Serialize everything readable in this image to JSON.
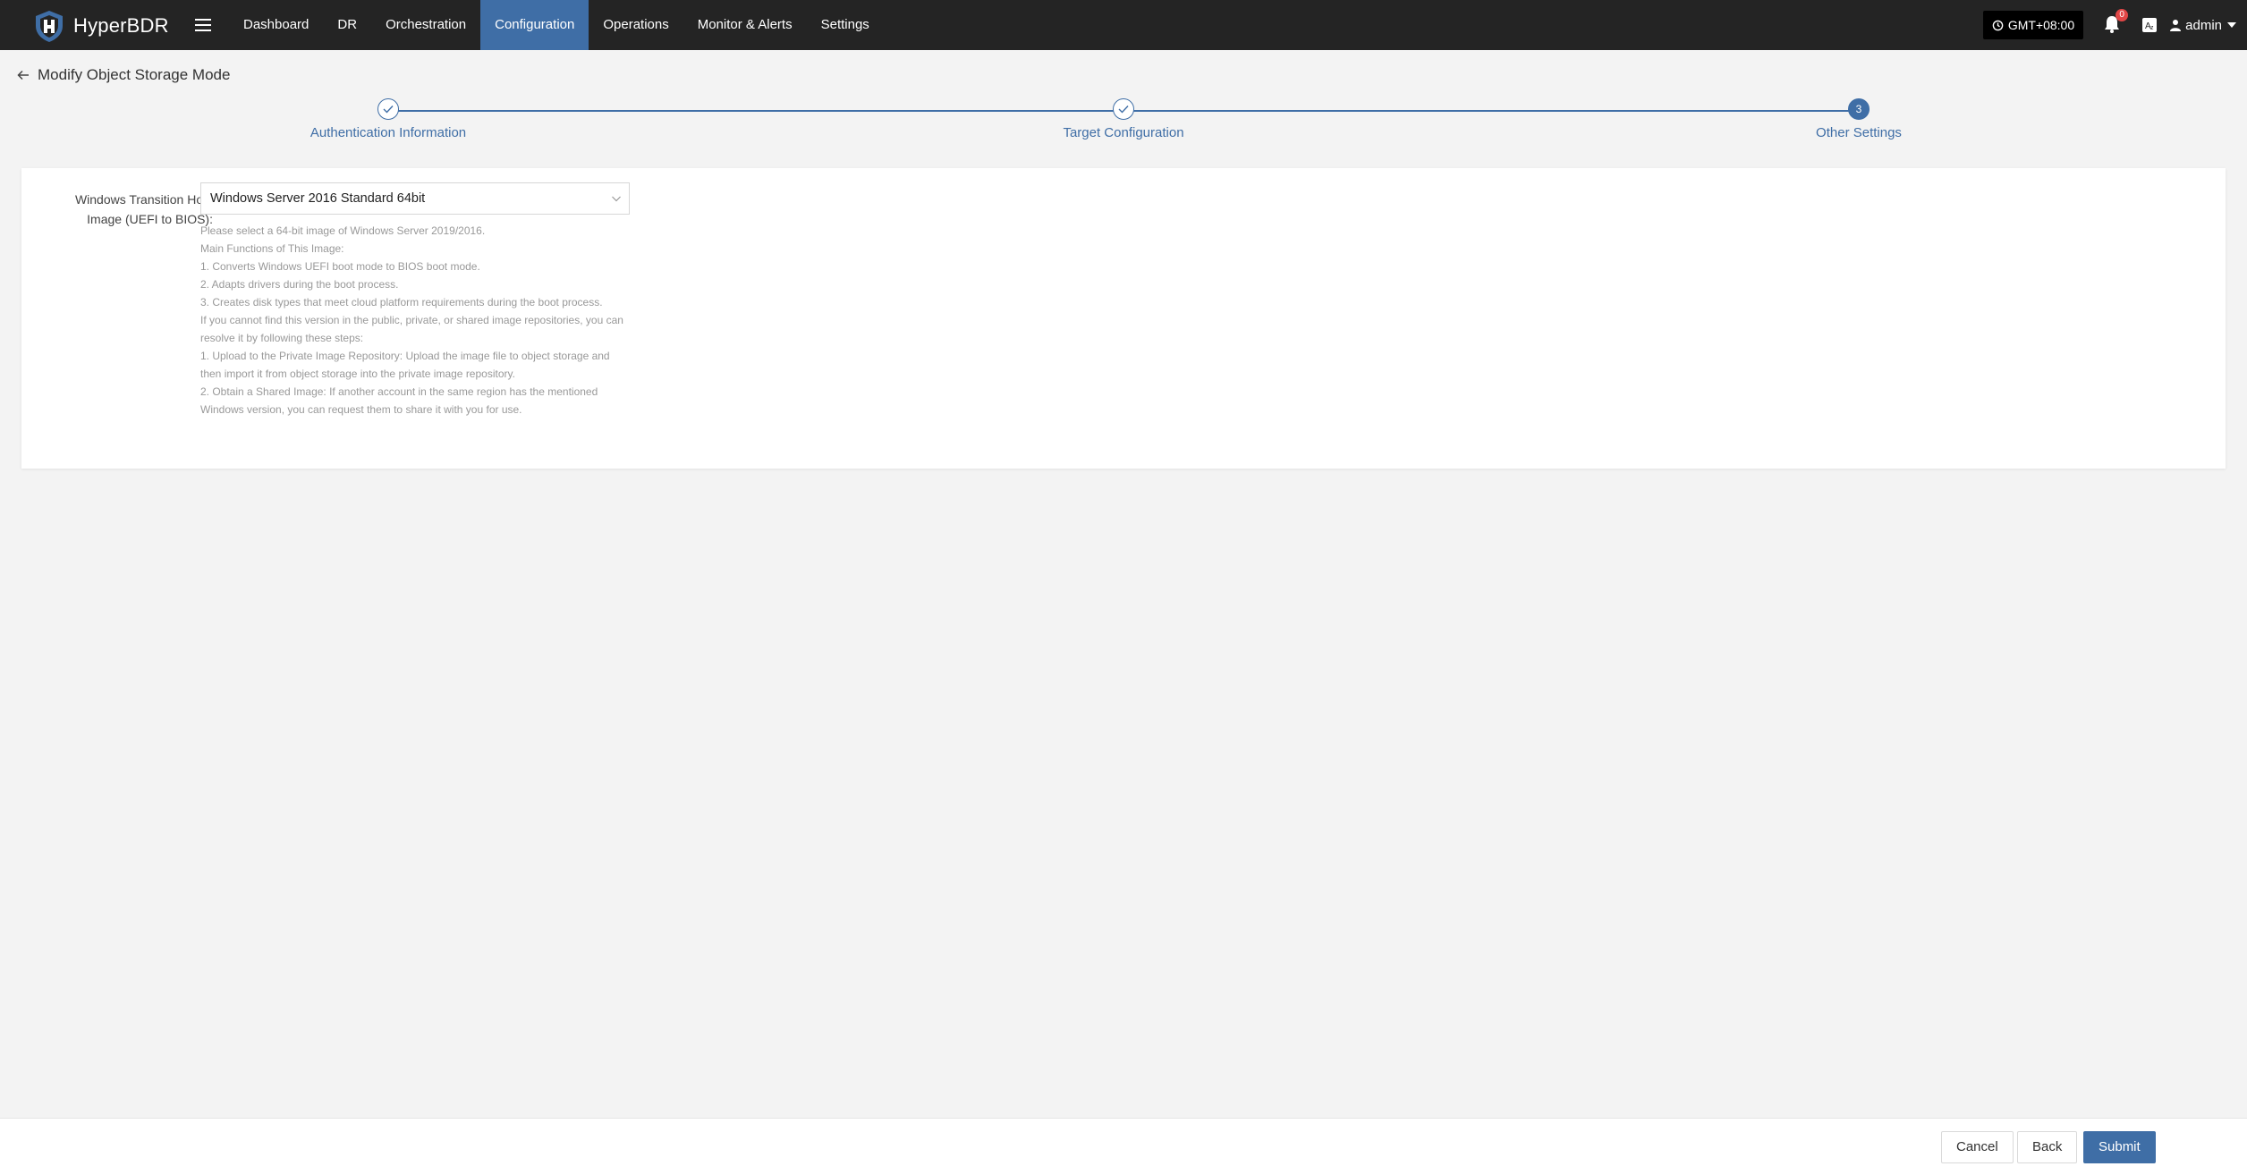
{
  "app": {
    "name": "HyperBDR"
  },
  "nav": {
    "items": [
      {
        "label": "Dashboard"
      },
      {
        "label": "DR"
      },
      {
        "label": "Orchestration"
      },
      {
        "label": "Configuration"
      },
      {
        "label": "Operations"
      },
      {
        "label": "Monitor & Alerts"
      },
      {
        "label": "Settings"
      }
    ],
    "active_index": 3,
    "timezone": "GMT+08:00",
    "notification_count": "0",
    "user": "admin"
  },
  "page": {
    "title": "Modify Object Storage Mode"
  },
  "steps": [
    {
      "label": "Authentication Information",
      "status": "done"
    },
    {
      "label": "Target Configuration",
      "status": "done"
    },
    {
      "label": "Other Settings",
      "status": "current",
      "number": "3"
    }
  ],
  "form": {
    "label_line1": "Windows Transition Host",
    "label_line2": "Image (UEFI to BIOS):",
    "select_value": "Windows Server 2016 Standard 64bit",
    "help_lines": [
      "Please select a 64-bit image of Windows Server 2019/2016.",
      "Main Functions of This Image:",
      "1. Converts Windows UEFI boot mode to BIOS boot mode.",
      "2. Adapts drivers during the boot process.",
      "3. Creates disk types that meet cloud platform requirements during the boot process.",
      "If you cannot find this version in the public, private, or shared image repositories, you can",
      "resolve it by following these steps:",
      "1. Upload to the Private Image Repository: Upload the image file to object storage and",
      "then import it from object storage into the private image repository.",
      "2. Obtain a Shared Image: If another account in the same region has the mentioned",
      "Windows version, you can request them to share it with you for use."
    ]
  },
  "footer": {
    "cancel": "Cancel",
    "back": "Back",
    "submit": "Submit"
  },
  "colors": {
    "accent": "#3f6ea6",
    "navbar": "#242424",
    "background": "#f3f3f3"
  }
}
